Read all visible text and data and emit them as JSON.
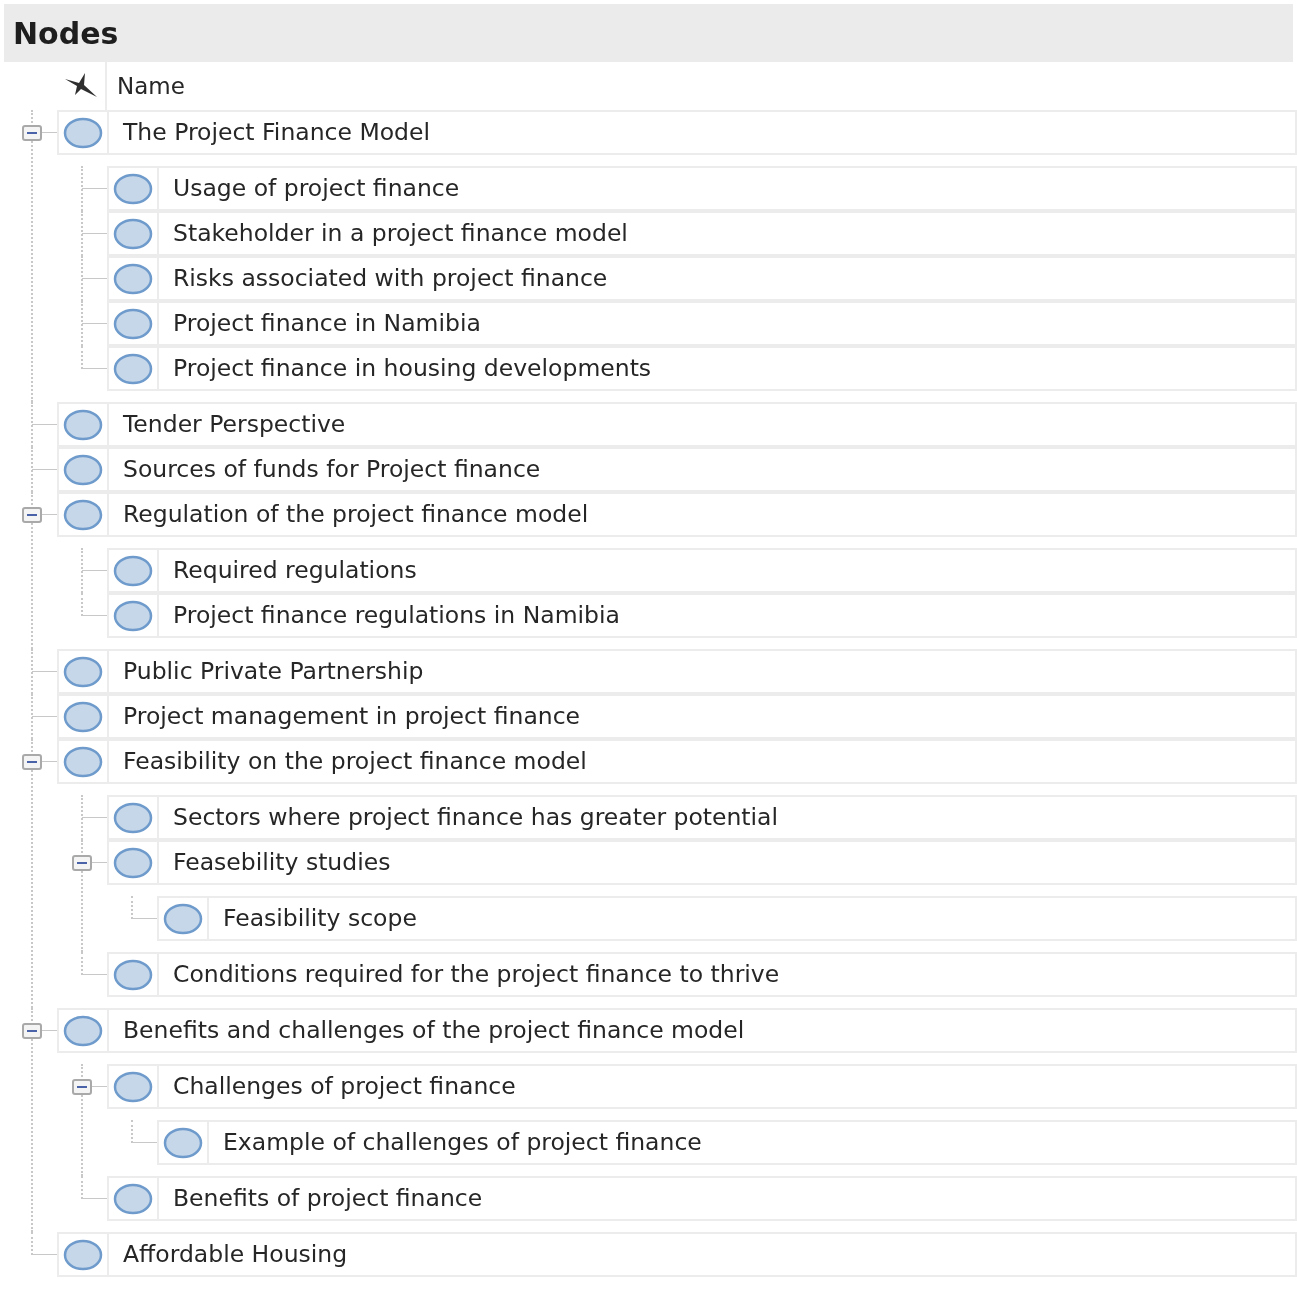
{
  "title": "Nodes",
  "column_header": "Name",
  "nodes": [
    {
      "name": "The Project Finance Model",
      "expanded": true,
      "children": [
        {
          "name": "Usage of project finance"
        },
        {
          "name": "Stakeholder in a project finance model"
        },
        {
          "name": "Risks associated with project finance"
        },
        {
          "name": "Project finance in Namibia"
        },
        {
          "name": "Project finance in housing developments"
        }
      ]
    },
    {
      "name": "Tender Perspective"
    },
    {
      "name": "Sources of funds for Project finance"
    },
    {
      "name": "Regulation of the project finance model",
      "expanded": true,
      "children": [
        {
          "name": "Required regulations"
        },
        {
          "name": "Project finance regulations in Namibia"
        }
      ]
    },
    {
      "name": "Public Private Partnership"
    },
    {
      "name": "Project management in project finance"
    },
    {
      "name": "Feasibility on the project finance model",
      "expanded": true,
      "children": [
        {
          "name": "Sectors where project finance has greater potential"
        },
        {
          "name": "Feasebility studies",
          "expanded": true,
          "children": [
            {
              "name": "Feasibility scope"
            }
          ]
        },
        {
          "name": "Conditions required for the project finance to thrive"
        }
      ]
    },
    {
      "name": "Benefits and challenges of the project finance model",
      "expanded": true,
      "children": [
        {
          "name": "Challenges of project finance",
          "expanded": true,
          "children": [
            {
              "name": "Example of challenges of project finance"
            }
          ]
        },
        {
          "name": "Benefits of project finance"
        }
      ]
    },
    {
      "name": "Affordable Housing"
    }
  ]
}
